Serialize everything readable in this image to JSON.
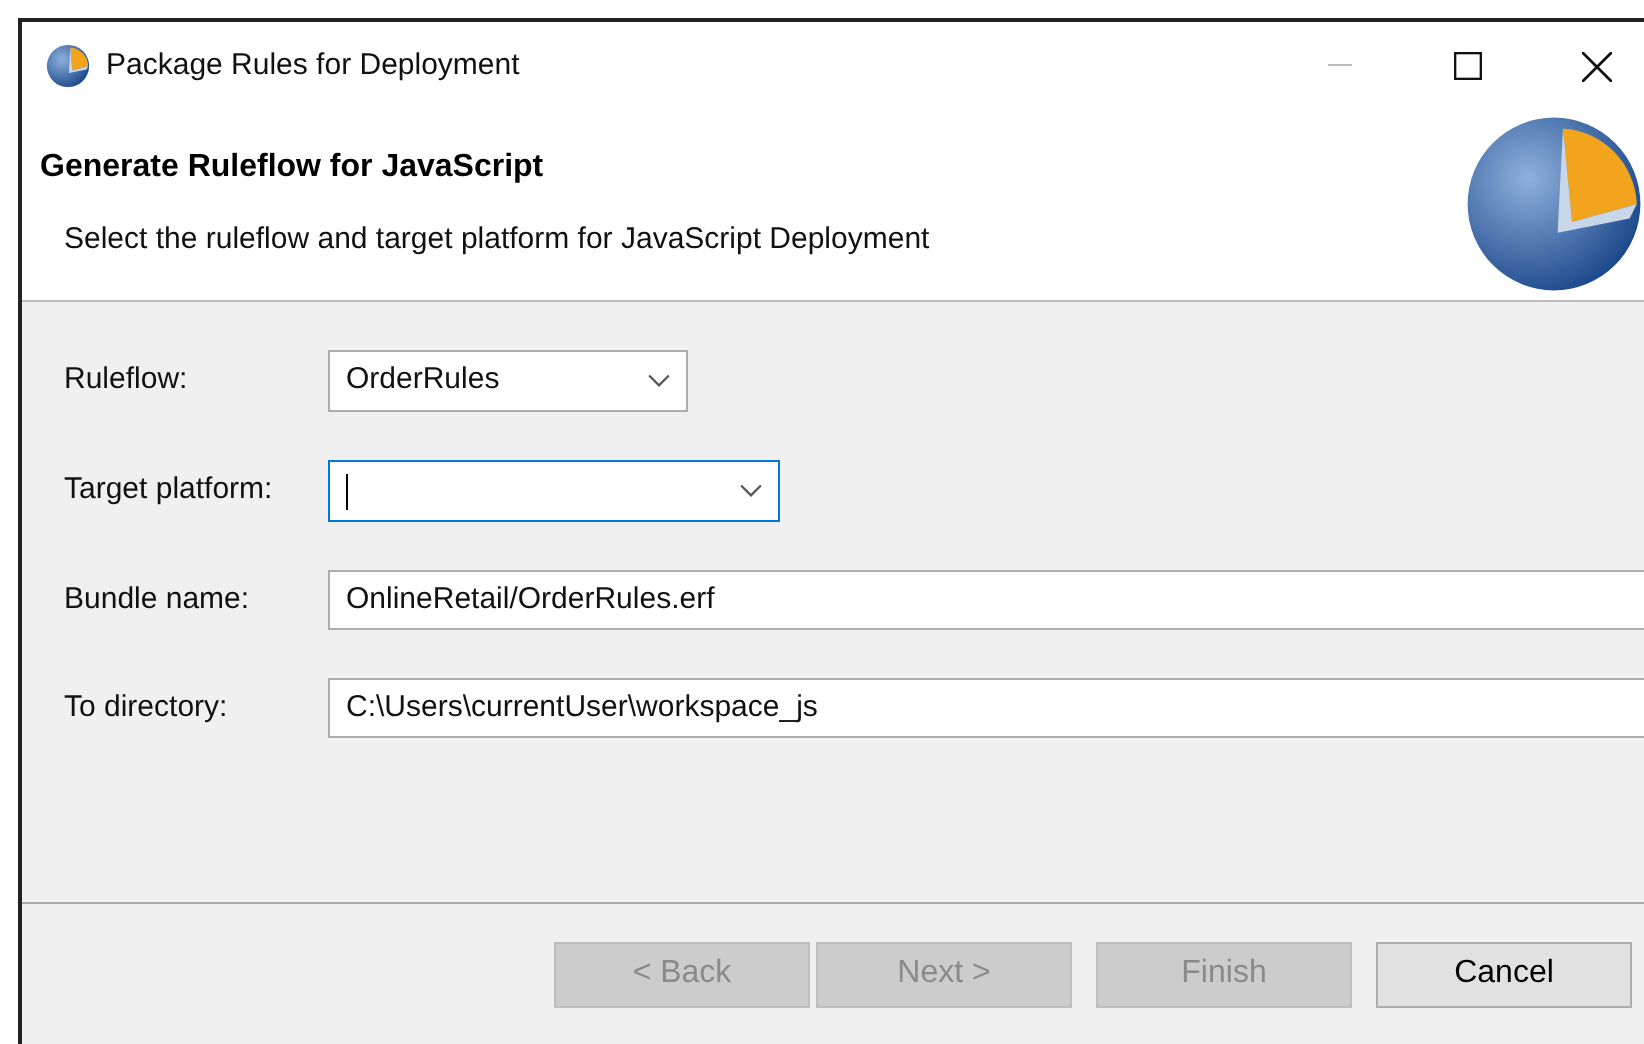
{
  "window": {
    "title": "Package Rules for Deployment"
  },
  "header": {
    "title": "Generate Ruleflow for JavaScript",
    "description": "Select the ruleflow and target platform for JavaScript Deployment"
  },
  "fields": [
    {
      "label": "Ruleflow:",
      "kind": "combo",
      "value": "OrderRules",
      "focused": false
    },
    {
      "label": "Target platform:",
      "kind": "combo",
      "focused": true
    },
    {
      "label": "Bundle name:",
      "kind": "text",
      "value": "OnlineRetail/OrderRules.erf",
      "focused": false
    },
    {
      "label": "To directory:",
      "kind": "text",
      "value": "C:\\Users\\currentUser\\workspace_js",
      "focused": false
    }
  ],
  "buttons": [
    {
      "label": "< Back",
      "disabled": true
    },
    {
      "label": "Next >",
      "disabled": true
    },
    {
      "label": "Finish",
      "disabled": true
    },
    {
      "label": "Cancel",
      "disabled": false
    }
  ]
}
